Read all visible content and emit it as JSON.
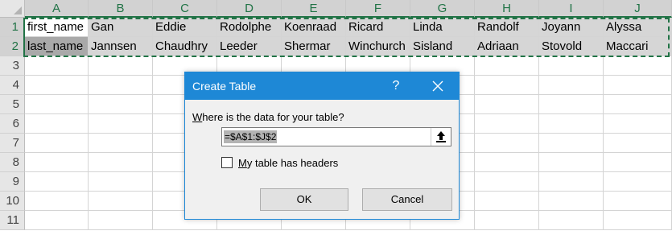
{
  "columns": [
    "A",
    "B",
    "C",
    "D",
    "E",
    "F",
    "G",
    "H",
    "I",
    "J"
  ],
  "rows": [
    "1",
    "2",
    "3",
    "4",
    "5",
    "6",
    "7",
    "8",
    "9",
    "10",
    "11"
  ],
  "cells": [
    [
      "first_name",
      "Gan",
      "Eddie",
      "Rodolphe",
      "Koenraad",
      "Ricard",
      "Linda",
      "Randolf",
      "Joyann",
      "Alyssa"
    ],
    [
      "last_name",
      "Jannsen",
      "Chaudhry",
      "Leeder",
      "Shermar",
      "Winchurch",
      "Sisland",
      "Adriaan",
      "Stovold",
      "Maccari"
    ]
  ],
  "dialog": {
    "title": "Create Table",
    "help": "?",
    "prompt_prefix": "W",
    "prompt_rest": "here is the data for your table?",
    "range": "=$A$1:$J$2",
    "checkbox_prefix": "M",
    "checkbox_rest": "y table has headers",
    "checkbox_checked": false,
    "ok": "OK",
    "cancel": "Cancel"
  },
  "colors": {
    "accent": "#1e88d6",
    "excel_green": "#217346"
  }
}
